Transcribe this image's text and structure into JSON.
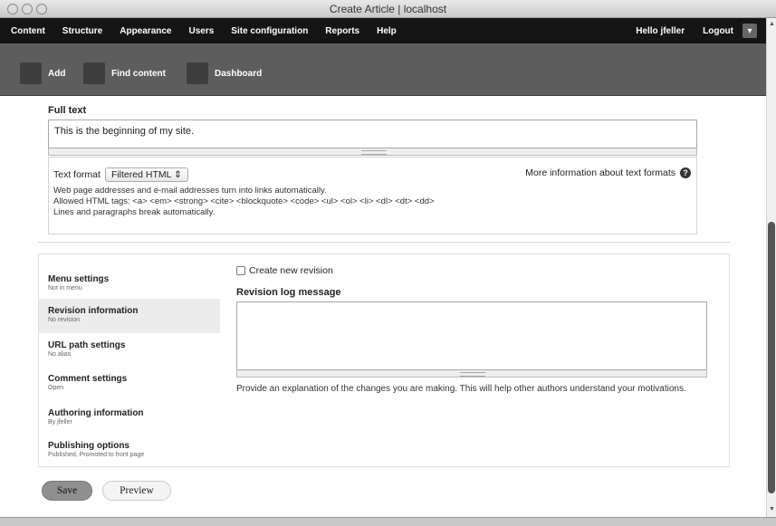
{
  "window": {
    "title": "Create Article | localhost"
  },
  "toolbar": {
    "menu": [
      "Content",
      "Structure",
      "Appearance",
      "Users",
      "Site configuration",
      "Reports",
      "Help"
    ],
    "user_greeting": "Hello jfeller",
    "logout": "Logout",
    "toggle_icon": "chevron-down-icon"
  },
  "shortcuts": [
    {
      "label": "Add",
      "icon": "add-icon"
    },
    {
      "label": "Find content",
      "icon": "find-content-icon"
    },
    {
      "label": "Dashboard",
      "icon": "dashboard-icon"
    }
  ],
  "body_field": {
    "label": "Full text",
    "value": "This is the beginning of my site."
  },
  "text_format": {
    "label": "Text format",
    "selected": "Filtered HTML",
    "more_info": "More information about text formats",
    "tips": [
      "Web page addresses and e-mail addresses turn into links automatically.",
      "Allowed HTML tags: <a> <em> <strong> <cite> <blockquote> <code> <ul> <ol> <li> <dl> <dt> <dd>",
      "Lines and paragraphs break automatically."
    ]
  },
  "vertical_tabs": [
    {
      "name": "Menu settings",
      "summary": "Not in menu",
      "active": false
    },
    {
      "name": "Revision information",
      "summary": "No revision",
      "active": true
    },
    {
      "name": "URL path settings",
      "summary": "No alias",
      "active": false
    },
    {
      "name": "Comment settings",
      "summary": "Open",
      "active": false
    },
    {
      "name": "Authoring information",
      "summary": "By jfeller",
      "active": false
    },
    {
      "name": "Publishing options",
      "summary": "Published, Promoted to front page",
      "active": false
    }
  ],
  "revision": {
    "checkbox_label": "Create new revision",
    "checked": false,
    "log_label": "Revision log message",
    "log_value": "",
    "description": "Provide an explanation of the changes you are making. This will help other authors understand your motivations."
  },
  "actions": {
    "save": "Save",
    "preview": "Preview"
  }
}
